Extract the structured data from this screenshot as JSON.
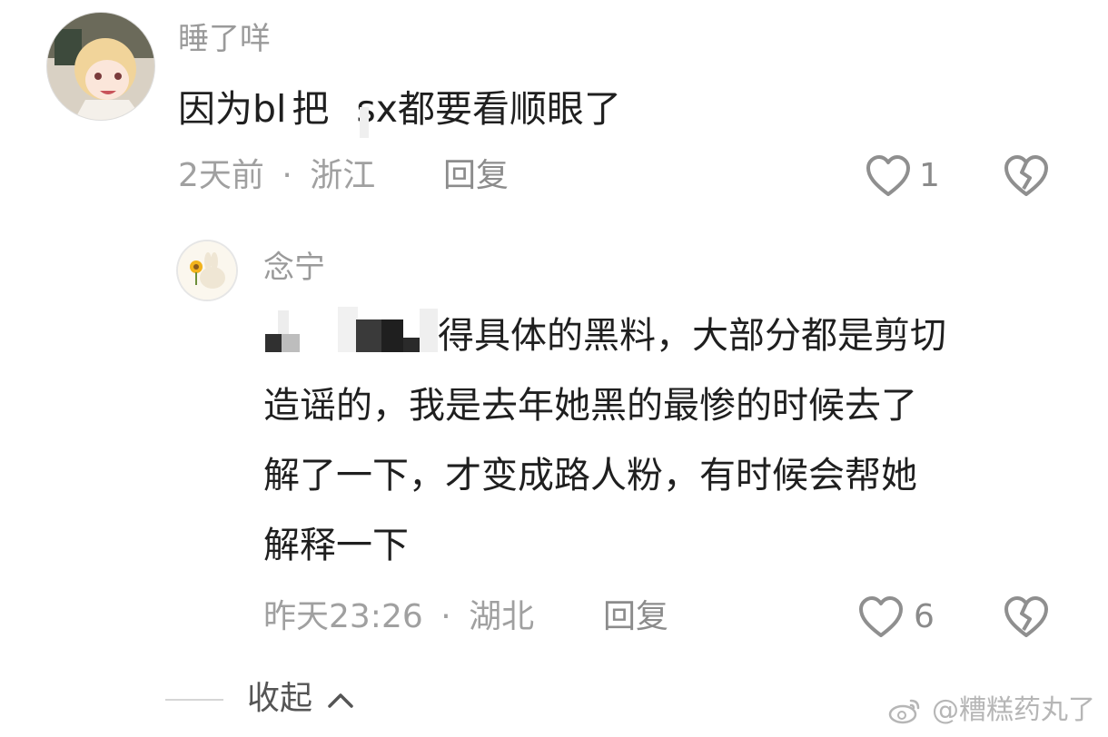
{
  "comment": {
    "username": "睡了咩",
    "text_part1": "因为bl",
    "text_part2": "把",
    "text_part3": "sx都要看顺眼了",
    "time": "2天前",
    "separator": "·",
    "location": "浙江",
    "reply_label": "回复",
    "likes": "1"
  },
  "reply": {
    "username": "念宁",
    "text_line1_visible": "得具体的黑料，大部分都是剪切",
    "text_line2": "造谣的，我是去年她黑的最惨的时候去了",
    "text_line3": "解了一下，才变成路人粉，有时候会帮她",
    "text_line4": "解释一下",
    "time": "昨天23:26",
    "separator": "·",
    "location": "湖北",
    "reply_label": "回复",
    "likes": "6"
  },
  "collapse_label": "收起",
  "watermark": "@糟糕药丸了",
  "colors": {
    "text": "#1f1f1f",
    "muted": "#9a9a9a",
    "icon": "#8f8f8f"
  },
  "icons": [
    "heart-icon",
    "broken-heart-icon",
    "chevron-up-icon",
    "weibo-logo"
  ]
}
